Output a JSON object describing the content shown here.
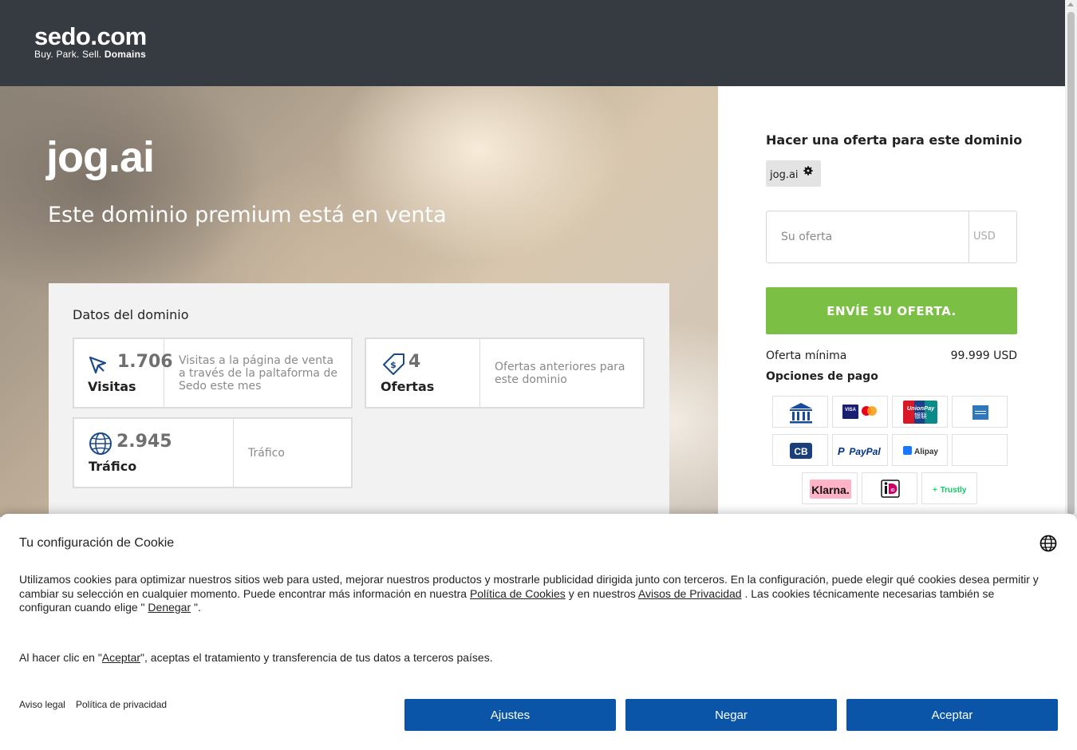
{
  "header": {
    "logo": "sedo.com",
    "tagline_prefix": "Buy.  Park.  Sell.",
    "tagline_bold": "Domains"
  },
  "hero": {
    "domain": "jog.ai",
    "subtitle": "Este dominio premium está en venta"
  },
  "domain_data": {
    "title": "Datos del dominio",
    "stats": [
      {
        "number": "1.706",
        "label": "Visitas",
        "description": "Visitas a la página de venta a través de la paltaforma de Sedo este mes",
        "icon": "cursor-icon"
      },
      {
        "number": "4",
        "label": "Ofertas",
        "description": "Ofertas anteriores para este dominio",
        "icon": "price-tag-icon"
      },
      {
        "number": "2.945",
        "label": "Tráfico",
        "description": "Tráfico",
        "icon": "globe-icon"
      }
    ]
  },
  "offer": {
    "title": "Hacer una oferta para este dominio",
    "domain_chip": "jog.ai",
    "input_placeholder": "Su oferta",
    "currency": "USD",
    "button": "ENVÍE SU OFERTA.",
    "min_label": "Oferta mínima",
    "min_value": "99.999 USD",
    "payment_label": "Opciones de pago",
    "payment_methods": [
      "bank-transfer-icon",
      "visa-mastercard-icon",
      "unionpay-icon",
      "american-express-icon",
      "cb-icon",
      "paypal-icon",
      "alipay-icon",
      "empty-icon",
      "klarna-icon",
      "ideal-icon",
      "trustly-icon"
    ],
    "payment_texts": {
      "unionpay": "UnionPay",
      "unionpay_cn": "银联",
      "paypal": "PayPal",
      "alipay": "Alipay",
      "klarna": "Klarna.",
      "trustly": "Trustly",
      "cb": "CB",
      "visa": "VISA",
      "ideal": "iD"
    }
  },
  "cookie": {
    "title": "Tu configuración de Cookie",
    "text_1": "Utilizamos cookies para optimizar nuestros sitios web para usted, mejorar nuestros productos y mostrarle publicidad dirigida junto con terceros. En la configuración, puede elegir qué cookies desea permitir y cambiar su selección en cualquier momento. Puede encontrar más información en nuestra ",
    "link_cookies": "Política de Cookies",
    "text_2": " y en nuestros ",
    "link_privacy": "Avisos de Privacidad",
    "text_3": " . Las cookies técnicamente necesarias también se configuran cuando elige \" ",
    "link_deny": "Denegar",
    "text_4": " \".",
    "accept_pre": "Al hacer clic en \"",
    "accept_link": "Aceptar",
    "accept_post": "\", aceptas el tratamiento y transferencia de tus datos a terceros países.",
    "legal_link": "Aviso legal",
    "privacy_link": "Política de privacidad",
    "btn_settings": "Ajustes",
    "btn_deny": "Negar",
    "btn_accept": "Aceptar"
  }
}
